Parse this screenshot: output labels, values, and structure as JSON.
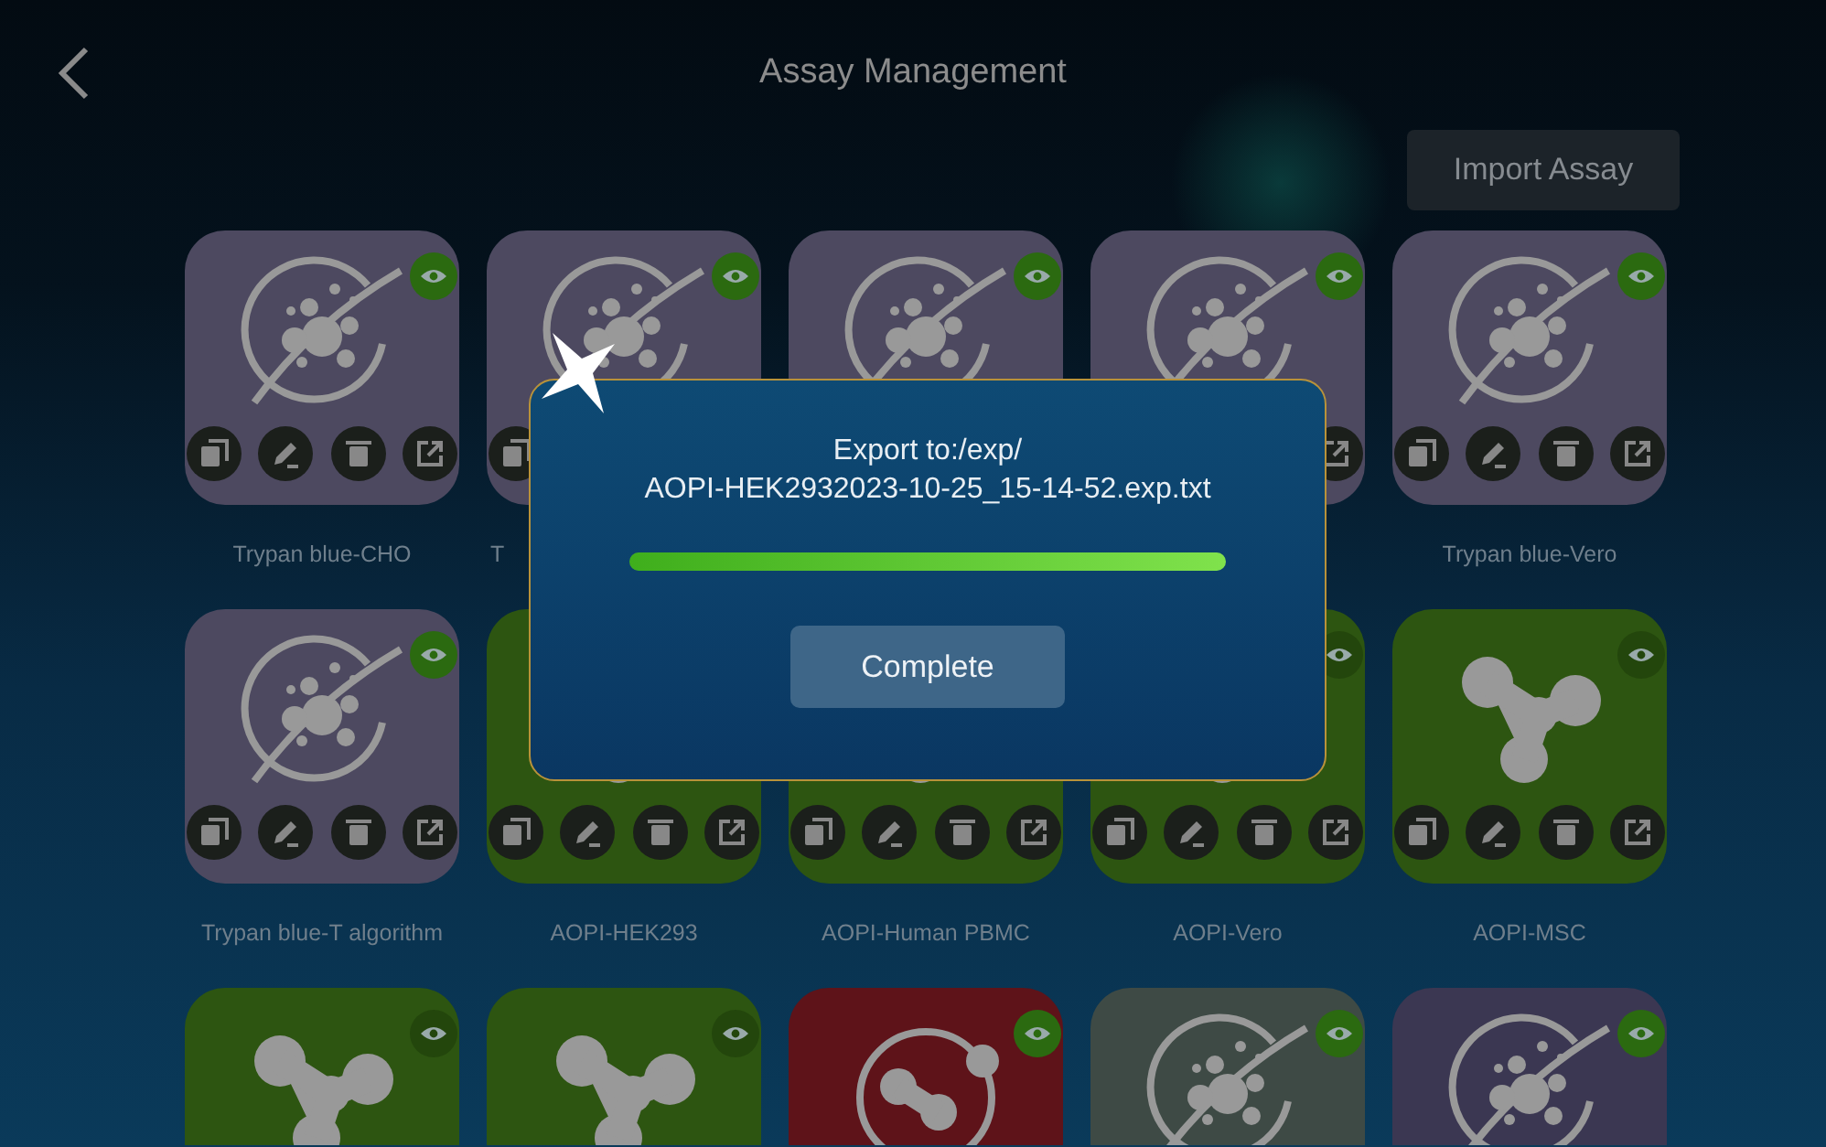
{
  "title": "Assay Management",
  "import_button": "Import Assay",
  "assays": [
    {
      "name": "Trypan blue-CHO",
      "kind": "cells",
      "color": "#4d4960"
    },
    {
      "name": "T",
      "kind": "cells",
      "color": "#4d4960",
      "covered": true
    },
    {
      "kind": "cells",
      "color": "#4d4960"
    },
    {
      "kind": "cells",
      "color": "#4d4960"
    },
    {
      "name": "Trypan blue-Vero",
      "kind": "cells",
      "color": "#4d4960"
    },
    {
      "name": "Trypan blue-T algorithm",
      "kind": "cells",
      "color": "#4d4960"
    },
    {
      "name": "AOPI-HEK293",
      "kind": "molecule",
      "color": "#2d5511"
    },
    {
      "name": "AOPI-Human PBMC",
      "kind": "molecule",
      "color": "#2d5511"
    },
    {
      "name": "AOPI-Vero",
      "kind": "molecule",
      "color": "#2d5511"
    },
    {
      "name": "AOPI-MSC",
      "kind": "molecule",
      "color": "#2d5511"
    },
    {
      "kind": "molecule",
      "color": "#2d5511"
    },
    {
      "kind": "molecule",
      "color": "#2d5511"
    },
    {
      "kind": "ring",
      "color": "#5e1319"
    },
    {
      "kind": "cells",
      "color": "#3e4a45"
    },
    {
      "kind": "cells",
      "color": "#3b3752"
    }
  ],
  "dialog": {
    "lines": [
      "Export to:/exp/",
      "AOPI-HEK2932023-10-25_15-14-52.exp.txt"
    ],
    "progress": {
      "level": 1
    },
    "button": "Complete"
  }
}
